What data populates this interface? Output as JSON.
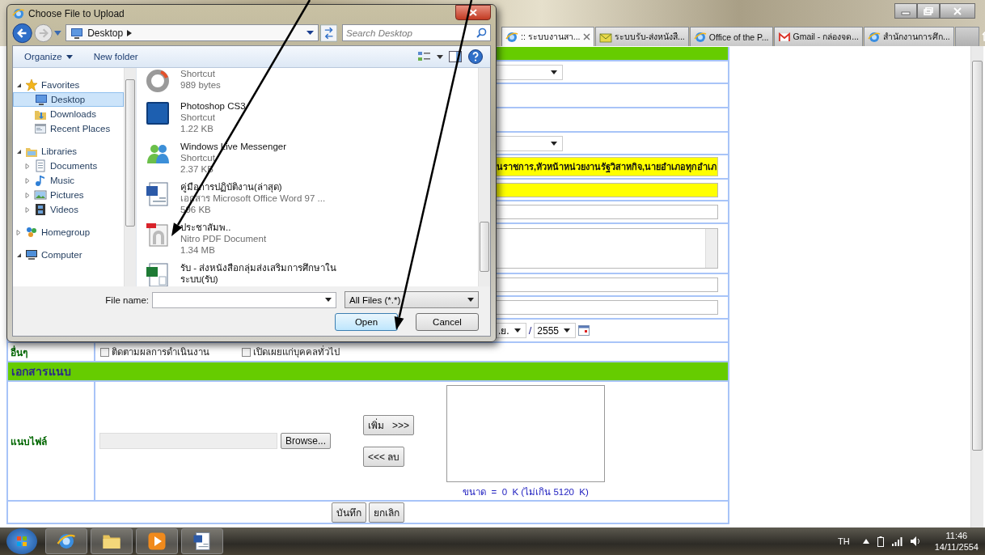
{
  "browser": {
    "tabs": [
      {
        "label": ":: ระบบงานสา...",
        "selected": true
      },
      {
        "label": "ระบบรับ-ส่งหนังสื...",
        "selected": false
      },
      {
        "label": "Office of the P...",
        "selected": false
      },
      {
        "label": "Gmail - กล่องจด...",
        "selected": false
      },
      {
        "label": "สำนักงานการศึก...",
        "selected": false
      }
    ]
  },
  "form": {
    "rows": [
      {
        "kind": "header"
      },
      {
        "kind": "select"
      },
      {
        "kind": "blank"
      },
      {
        "kind": "blank"
      },
      {
        "kind": "select"
      },
      {
        "kind": "highlight_text",
        "text": "นราชการ,หัวหน้าหน่วยงานรัฐวิสาหกิจ,นายอำเภอทุกอำเภ"
      },
      {
        "kind": "highlight_input"
      },
      {
        "kind": "input"
      },
      {
        "kind": "textarea"
      },
      {
        "kind": "input"
      },
      {
        "kind": "input"
      },
      {
        "kind": "date",
        "month": ".ย.",
        "separator": "/",
        "year": "2555"
      },
      {
        "kind": "checks",
        "label": "อื่นๆ",
        "checks": [
          {
            "label": "ติดตามผลการดำเนินงาน",
            "checked": false
          },
          {
            "label": "เปิดเผยแก่บุคคลทั่วไป",
            "checked": false
          }
        ]
      }
    ],
    "attachments": {
      "title": "เอกสารแนบ",
      "label": "แนบไฟล์",
      "browse": "Browse...",
      "add": "เพิ่ม   >>>",
      "remove": "<<< ลบ",
      "size_note": "ขนาด  =  0  K (ไม่เกิน 5120  K)"
    },
    "actions": [
      "บันทึก",
      "ยกเลิก"
    ]
  },
  "dialog": {
    "title": "Choose File to Upload",
    "address": "Desktop",
    "search": {
      "placeholder": "Search Desktop"
    },
    "toolbar": [
      "Organize",
      "New folder"
    ],
    "sidebar": {
      "items": [
        {
          "label": "Favorites",
          "expanded": true,
          "selected": false,
          "children": [
            {
              "label": "Desktop",
              "selected": true
            },
            {
              "label": "Downloads",
              "selected": false
            },
            {
              "label": "Recent Places",
              "selected": false
            }
          ]
        },
        {
          "label": "Libraries",
          "expanded": true,
          "selected": false,
          "children": [
            {
              "label": "Documents",
              "expanded": false,
              "selected": false
            },
            {
              "label": "Music",
              "expanded": false,
              "selected": false
            },
            {
              "label": "Pictures",
              "expanded": false,
              "selected": false
            },
            {
              "label": "Videos",
              "expanded": false,
              "selected": false
            }
          ]
        },
        {
          "label": "Homegroup",
          "expanded": false,
          "selected": false
        },
        {
          "label": "Computer",
          "expanded": true,
          "selected": false
        }
      ]
    },
    "files": [
      {
        "type": "Shortcut",
        "size": "989 bytes"
      },
      {
        "name": "Photoshop CS3",
        "type": "Shortcut",
        "size": "1.22 KB"
      },
      {
        "name": "Windows Live Messenger",
        "type": "Shortcut",
        "size": "2.37 KB"
      },
      {
        "name": "คู่มือการปฏิบัติงาน(ล่าสุด)",
        "type": "เอกสาร Microsoft Office Word 97 ...",
        "size": "596 KB"
      },
      {
        "name": "ประชาสัมพ..",
        "type": "Nitro PDF Document",
        "size": "1.34 MB"
      },
      {
        "name": "รับ - ส่งหนังสือกลุ่มส่งเสริมการศึกษาใน ระบบ(รับ)"
      }
    ],
    "file_name_label": "File name:",
    "filter": "All Files (*.*)",
    "buttons": [
      "Open",
      "Cancel"
    ]
  },
  "taskbar": {
    "tray": {
      "language": "TH",
      "time": "11:46",
      "date": "14/11/2554"
    }
  }
}
